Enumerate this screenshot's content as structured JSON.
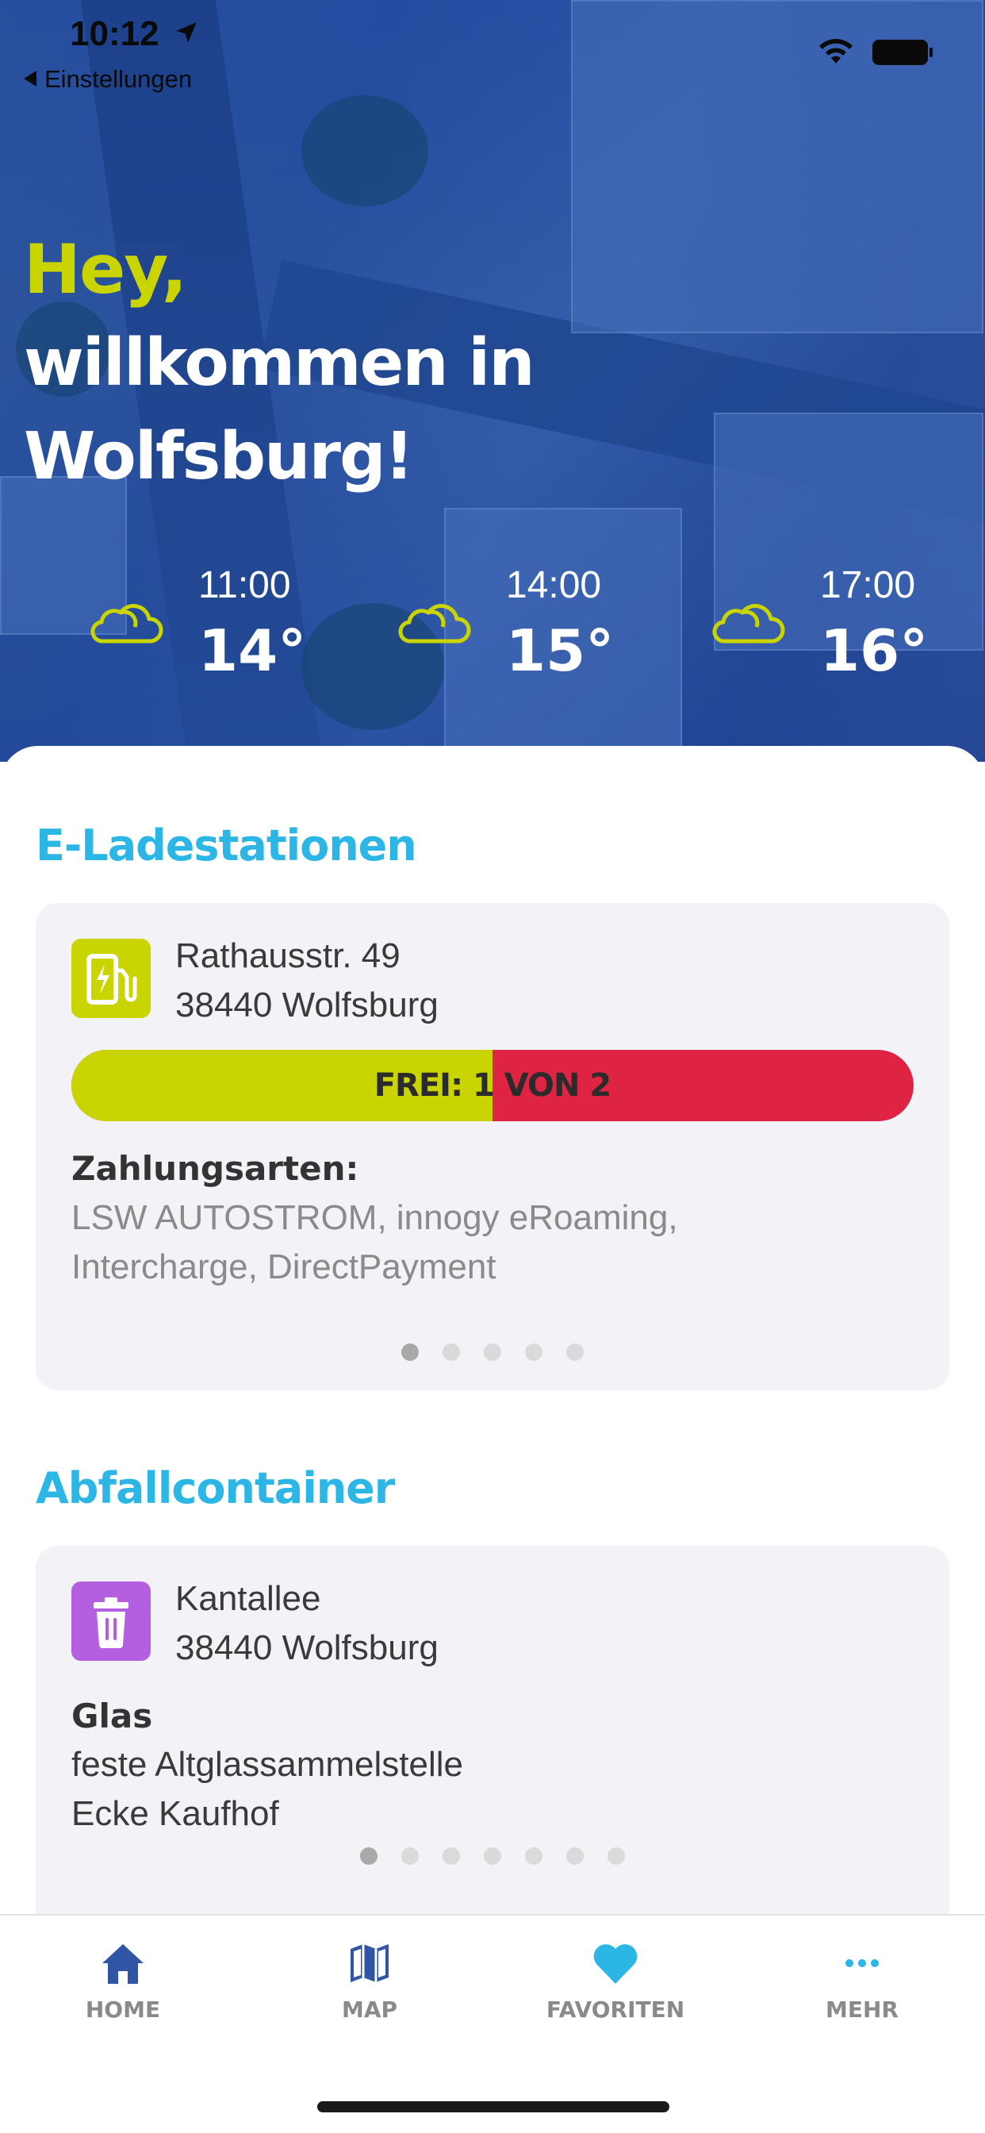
{
  "status_bar": {
    "time": "10:12",
    "back_label": "Einstellungen"
  },
  "hero": {
    "greeting_accent": "Hey,",
    "greeting_line1": "willkommen in",
    "greeting_line2": "Wolfsburg!",
    "weather": [
      {
        "time": "11:00",
        "temp": "14°",
        "icon": "cloud-icon"
      },
      {
        "time": "14:00",
        "temp": "15°",
        "icon": "cloud-icon"
      },
      {
        "time": "17:00",
        "temp": "16°",
        "icon": "cloud-icon"
      }
    ]
  },
  "charging": {
    "title": "E-Ladestationen",
    "address_line1": "Rathausstr. 49",
    "address_line2": "38440 Wolfsburg",
    "availability_label": "FREI: 1 VON 2",
    "free_count": 1,
    "total_count": 2,
    "payment_heading": "Zahlungsarten:",
    "payment_line1": "LSW AUTOSTROM, innogy eRoaming,",
    "payment_line2": "Intercharge, DirectPayment",
    "icon": "ev-charger-icon",
    "page_count": 5,
    "active_page": 0
  },
  "waste": {
    "title": "Abfallcontainer",
    "address_line1": "Kantallee",
    "address_line2": "38440 Wolfsburg",
    "category": "Glas",
    "desc_line1": "feste Altglassammelstelle",
    "desc_line2": "Ecke Kaufhof",
    "icon": "trash-icon",
    "page_count": 7,
    "active_page": 0
  },
  "tabbar": {
    "items": [
      {
        "label": "HOME",
        "icon": "home-icon",
        "active": true
      },
      {
        "label": "MAP",
        "icon": "map-icon",
        "active": false
      },
      {
        "label": "FAVORITEN",
        "icon": "heart-icon",
        "active": false
      },
      {
        "label": "MEHR",
        "icon": "more-icon",
        "active": false
      }
    ]
  },
  "colors": {
    "accent_yellow": "#c9d400",
    "accent_blue": "#2bb6e6",
    "busy_red": "#de2442",
    "waste_purple": "#b45fe0",
    "tab_home": "#2f55a4"
  }
}
